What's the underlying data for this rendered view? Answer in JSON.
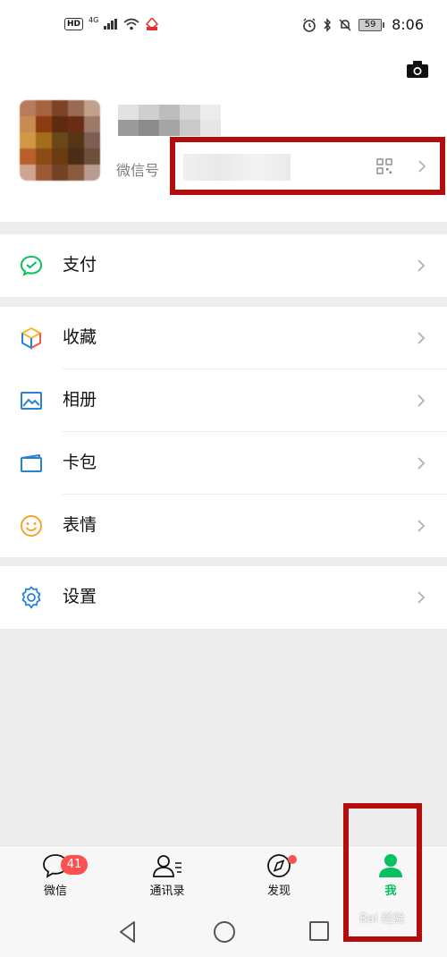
{
  "status_bar": {
    "hd": "HD",
    "network": "4G",
    "battery": "59",
    "time": "8:06"
  },
  "profile": {
    "wechat_id_label": "微信号"
  },
  "menu": {
    "pay": "支付",
    "favorites": "收藏",
    "album": "相册",
    "cards": "卡包",
    "stickers": "表情",
    "settings": "设置"
  },
  "tabs": {
    "chats": "微信",
    "chats_badge": "41",
    "contacts": "通讯录",
    "discover": "发现",
    "me": "我"
  },
  "watermark": "Bai 经验",
  "colors": {
    "accent_green": "#07c160",
    "badge_red": "#fa5151",
    "highlight_red": "#b40d0d",
    "background": "#ededed"
  }
}
